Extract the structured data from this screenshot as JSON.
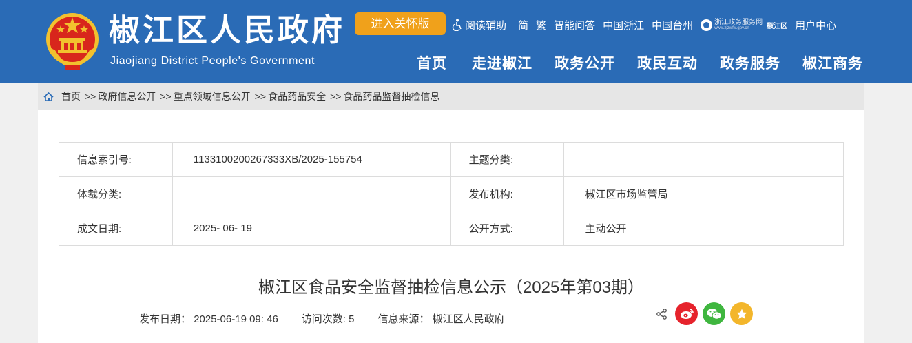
{
  "header": {
    "title": "椒江区人民政府",
    "subtitle": "Jiaojiang District People's Government",
    "care_button": "进入关怀版",
    "toplinks": {
      "reading": "阅读辅助",
      "simplified": "简",
      "traditional": "繁",
      "smart_qa": "智能问答",
      "zhejiang": "中国浙江",
      "taizhou": "中国台州",
      "zj_service_name": "浙江政务服务网",
      "zj_service_url_text": "www.zjzwfw.gov.cn",
      "jj_short": "椒江区",
      "user_center": "用户中心"
    },
    "nav": [
      "首页",
      "走进椒江",
      "政务公开",
      "政民互动",
      "政务服务",
      "椒江商务"
    ]
  },
  "breadcrumb": [
    "首页",
    "政府信息公开",
    "重点领域信息公开",
    "食品药品安全",
    "食品药品监督抽检信息"
  ],
  "breadcrumb_sep": ">>",
  "meta": {
    "index_label": "信息索引号:",
    "index_value": "1133100200267333XB/2025-155754",
    "topic_label": "主题分类:",
    "topic_value": "",
    "genre_label": "体裁分类:",
    "genre_value": "",
    "publisher_label": "发布机构:",
    "publisher_value": "椒江区市场监管局",
    "date_label": "成文日期:",
    "date_value": "2025- 06- 19",
    "open_label": "公开方式:",
    "open_value": "主动公开"
  },
  "article": {
    "title": "椒江区食品安全监督抽检信息公示（2025年第03期）",
    "pub_label": "发布日期：",
    "pub_value": "2025-06-19 09: 46",
    "visits_label": "访问次数:",
    "visits_value": "5",
    "source_label": "信息来源：",
    "source_value": "椒江区人民政府"
  },
  "colors": {
    "header_bg": "#2a6bb6",
    "care_btn": "#f0a11b",
    "weibo": "#e6232c",
    "wechat": "#3fb63f",
    "favorite": "#f3b62b"
  },
  "icons": [
    "national-emblem-icon",
    "accessibility-icon",
    "home-icon",
    "share-icon",
    "weibo-icon",
    "wechat-icon",
    "favorite-icon"
  ]
}
